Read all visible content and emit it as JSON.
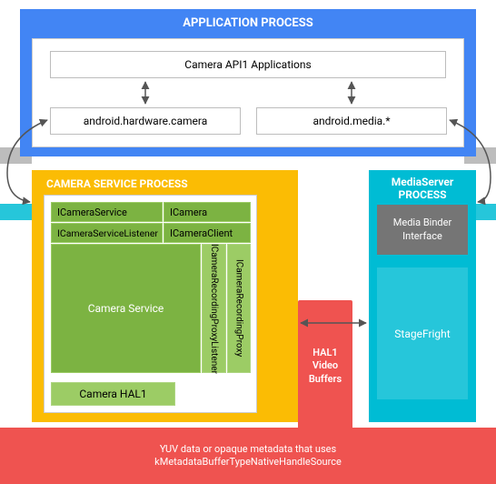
{
  "app_process": {
    "title": "APPLICATION PROCESS",
    "api1_apps": "Camera API1 Applications",
    "hw_camera": "android.hardware.camera",
    "media_star": "android.media.*"
  },
  "camera_service_process": {
    "title": "CAMERA SERVICE PROCESS",
    "icamera_service": "ICameraService",
    "icamera": "ICamera",
    "icamera_service_listener": "ICameraServiceListener",
    "icamera_client": "ICameraClient",
    "camera_service": "Camera Service",
    "irec_proxy_listener": "ICameraRecordingProxyListener",
    "irec_proxy": "ICameraRecordingProxy",
    "camera_hal1": "Camera HAL1"
  },
  "mediaserver_process": {
    "title_line1": "MediaServer",
    "title_line2": "PROCESS",
    "media_binder_interface": "Media Binder Interface",
    "stagefright": "StageFright"
  },
  "hal1_video_buffers": {
    "line1": "HAL1",
    "line2": "Video",
    "line3": "Buffers"
  },
  "bottom_caption": {
    "line1": "YUV data or opaque metadata that uses",
    "line2": "kMetadataBufferTypeNativeHandleSource"
  }
}
